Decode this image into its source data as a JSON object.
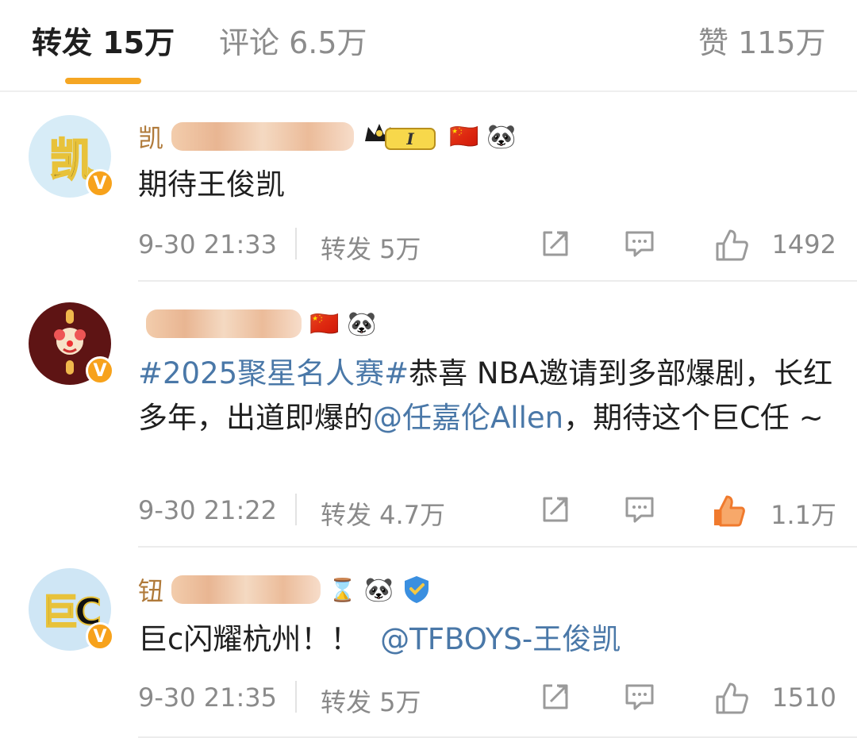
{
  "tabs": {
    "repost": "转发 15万",
    "comment": "评论 6.5万",
    "like": "赞 115万"
  },
  "comments": [
    {
      "avatar_text": "凯",
      "nickname_prefix": "凯",
      "text": "期待王俊凯",
      "time": "9-30 21:33",
      "repost": "转发 5万",
      "likes": "1492",
      "liked": false
    },
    {
      "avatar_text": "",
      "nickname_prefix": "",
      "hashtag": "#2025聚星名人赛#",
      "text_a": "恭喜 NBA邀请到多部爆剧，长红多年，出道即爆的",
      "mention": "@任嘉伦Allen",
      "text_b": "，期待这个巨C任 ~",
      "time": "9-30 21:22",
      "repost": "转发 4.7万",
      "likes": "1.1万",
      "liked": true
    },
    {
      "avatar_text": "巨C",
      "nickname_prefix": "钮",
      "text": "巨c闪耀杭州！！",
      "mention": "@TFBOYS-王俊凯",
      "time": "9-30 21:35",
      "repost": "转发 5万",
      "likes": "1510",
      "liked": false
    }
  ],
  "badges": {
    "verified": "V",
    "level": "I",
    "flag": "🇨🇳",
    "panda": "🐼",
    "hourglass": "⌛"
  },
  "colors": {
    "accent": "#f5a623",
    "link": "#4a78a8",
    "muted": "#8a8a8a",
    "liked": "#f07a2d"
  }
}
